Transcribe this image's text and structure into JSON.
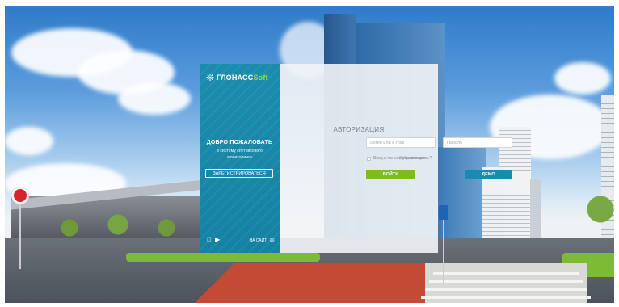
{
  "brand": {
    "logo_icon": "glonass-satellite-icon",
    "logo_main": "ГЛОНАСС",
    "logo_suffix": "Soft",
    "welcome": "ДОБРО ПОЖАЛОВАТЬ",
    "subtitle": "в систему спутникового мониторинга",
    "register_label": "ЗАРЕГИСТРИРОВАТЬСЯ",
    "store_icons": [
      "apple-icon",
      "google-play-icon"
    ],
    "site_label": "НА САЙТ"
  },
  "form": {
    "title": "АВТОРИЗАЦИЯ",
    "login_placeholder": "Логин или e-mail",
    "password_placeholder": "Пароль",
    "remember_label": "Вход в панель управления",
    "forgot_label": "Забыли пароль?",
    "login_button": "ВОЙТИ",
    "demo_button": "ДЕМО"
  },
  "colors": {
    "brand_panel": "#1a8aac",
    "login_button": "#7cbb21",
    "demo_button": "#1a8ab2",
    "logo_accent": "#9fd54a"
  }
}
